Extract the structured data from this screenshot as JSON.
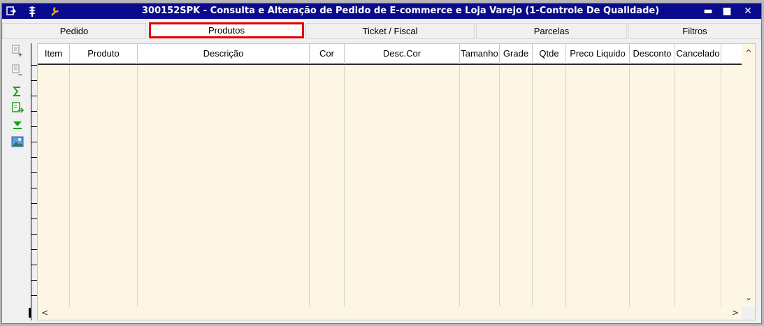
{
  "window": {
    "title": "300152SPK - Consulta e Alteração de Pedido de E-commerce e Loja Varejo (1-Controle De Qualidade)",
    "title_bar_color": "#0a0a8e",
    "controls": {
      "minimize": "▬",
      "maximize": "■",
      "close": "✕"
    },
    "icons": [
      "app-menu-icon",
      "layers-icon",
      "wrench-icon"
    ]
  },
  "tabs": [
    {
      "label": "Pedido",
      "active": false
    },
    {
      "label": "Produtos",
      "active": true
    },
    {
      "label": "Ticket / Fiscal",
      "active": false
    },
    {
      "label": "Parcelas",
      "active": false
    },
    {
      "label": "Filtros",
      "active": false
    }
  ],
  "toolbar": {
    "buttons": [
      "add-row-icon",
      "remove-row-icon",
      "sum-icon",
      "export-icon",
      "expand-down-icon",
      "image-icon"
    ]
  },
  "grid": {
    "columns": [
      "Item",
      "Produto",
      "Descrição",
      "Cor",
      "Desc.Cor",
      "Tamanho",
      "Grade",
      "Qtde",
      "Preco Liquido",
      "Desconto",
      "Cancelado"
    ],
    "rows": [],
    "background": "#fdf6e4"
  },
  "scrollbars": {
    "up": "^",
    "down": "⌄",
    "left": "<",
    "right": ">"
  },
  "highlight_color": "#e00000"
}
